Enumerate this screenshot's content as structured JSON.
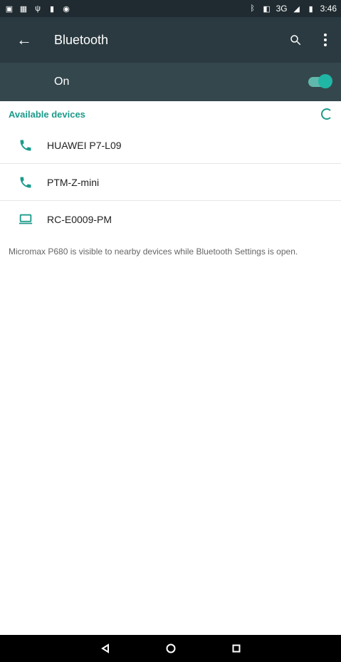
{
  "status_bar": {
    "left_icons": [
      "image-icon",
      "colorful-app-icon",
      "usb-icon",
      "battery-small-icon",
      "android-icon"
    ],
    "right_icons": [
      "bluetooth-icon",
      "vibrate-icon",
      "network-3g-icon",
      "signal-icon",
      "battery-icon"
    ],
    "network_text": "3G",
    "time": "3:46"
  },
  "toolbar": {
    "title": "Bluetooth",
    "back_icon": "back-arrow-icon",
    "search_icon": "search-icon",
    "more_icon": "more-vertical-icon"
  },
  "bluetooth_toggle": {
    "label": "On",
    "state": true
  },
  "available_devices": {
    "header": "Available devices",
    "items": [
      {
        "label": "HUAWEI P7-L09",
        "icon": "phone-icon"
      },
      {
        "label": "PTM-Z-mini",
        "icon": "phone-icon"
      },
      {
        "label": "RC-E0009-PM",
        "icon": "laptop-icon"
      }
    ]
  },
  "visibility_note": "Micromax P680 is visible to nearby devices while Bluetooth Settings is open.",
  "navbar": {
    "back": "nav-back-icon",
    "home": "nav-home-icon",
    "recents": "nav-recents-icon"
  },
  "colors": {
    "accent": "#1b9a8a",
    "toolbar": "#2a3a40",
    "onbar": "#34474d"
  }
}
